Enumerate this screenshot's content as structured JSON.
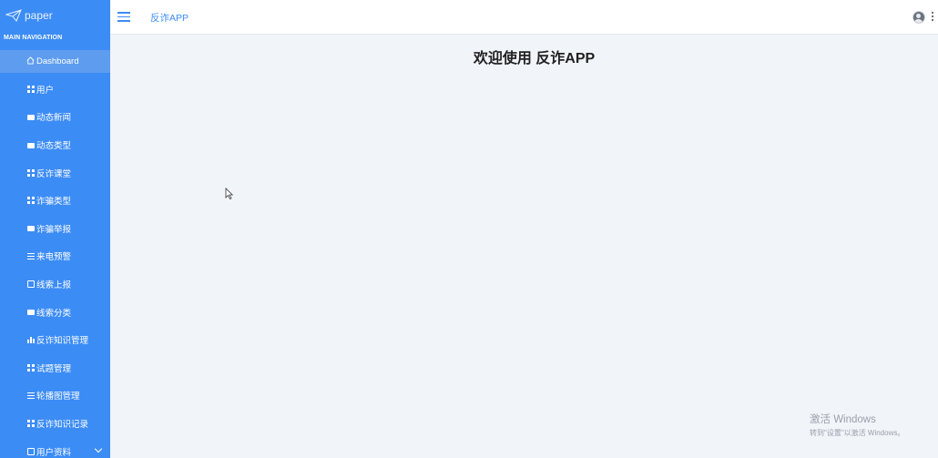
{
  "brand": {
    "logo_text": "paper",
    "logo_icon": "paper-plane-icon"
  },
  "sidebar": {
    "heading": "MAIN NAVIGATION",
    "items": [
      {
        "label": "Dashboard",
        "icon": "home-icon"
      },
      {
        "label": "用户",
        "icon": "grid-icon"
      },
      {
        "label": "动态新闻",
        "icon": "briefcase-icon"
      },
      {
        "label": "动态类型",
        "icon": "briefcase-icon"
      },
      {
        "label": "反诈课堂",
        "icon": "table-icon"
      },
      {
        "label": "诈骗类型",
        "icon": "grid-icon"
      },
      {
        "label": "诈骗举报",
        "icon": "monitor-icon"
      },
      {
        "label": "来电预警",
        "icon": "list-icon"
      },
      {
        "label": "线索上报",
        "icon": "book-icon"
      },
      {
        "label": "线索分类",
        "icon": "monitor-icon"
      },
      {
        "label": "反诈知识管理",
        "icon": "bar-chart-icon"
      },
      {
        "label": "试题管理",
        "icon": "grid-icon"
      },
      {
        "label": "轮播图管理",
        "icon": "list-icon"
      },
      {
        "label": "反诈知识记录",
        "icon": "grid-icon"
      },
      {
        "label": "用户资料",
        "icon": "calendar-icon"
      }
    ]
  },
  "header": {
    "app_title": "反诈APP"
  },
  "main": {
    "welcome": "欢迎使用 反诈APP"
  },
  "watermark": {
    "line1": "激活 Windows",
    "line2": "转到\"设置\"以激活 Windows。"
  },
  "colors": {
    "sidebar": "#3c8cf6",
    "active": "#5e9cf0",
    "background": "#f1f4f9"
  }
}
